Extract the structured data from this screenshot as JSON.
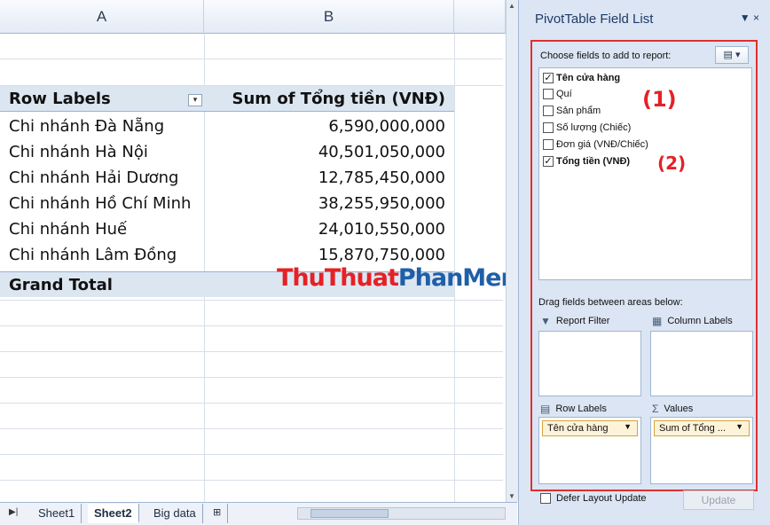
{
  "sheet": {
    "col_a": "A",
    "col_b": "B",
    "header": {
      "row_labels": "Row Labels",
      "sum_label": "Sum of Tổng tiền (VNĐ)"
    },
    "rows": [
      {
        "label": "Chi nhánh Đà Nẵng",
        "value": "6,590,000,000"
      },
      {
        "label": "Chi nhánh Hà Nội",
        "value": "40,501,050,000"
      },
      {
        "label": "Chi nhánh Hải Dương",
        "value": "12,785,450,000"
      },
      {
        "label": "Chi nhánh Hồ Chí Minh",
        "value": "38,255,950,000"
      },
      {
        "label": "Chi nhánh Huế",
        "value": "24,010,550,000"
      },
      {
        "label": "Chi nhánh Lâm Đồng",
        "value": "15,870,750,000"
      }
    ],
    "grand_total": "Grand Total",
    "watermark_red": "ThuThuat",
    "watermark_blue": "PhanMem.vn"
  },
  "tabs": [
    {
      "label": "Sheet1"
    },
    {
      "label": "Sheet2"
    },
    {
      "label": "Big data"
    }
  ],
  "pane": {
    "title": "PivotTable Field List",
    "close": "▼ ×",
    "choose_label": "Choose fields to add to report:",
    "fields": [
      {
        "label": "Tên cửa hàng",
        "checked": true
      },
      {
        "label": "Quí",
        "checked": false
      },
      {
        "label": "Sản phẩm",
        "checked": false
      },
      {
        "label": "Số lượng (Chiếc)",
        "checked": false
      },
      {
        "label": "Đơn giá (VNĐ/Chiếc)",
        "checked": false
      },
      {
        "label": "Tổng tiền (VNĐ)",
        "checked": true
      }
    ],
    "marker1": "(1)",
    "marker2": "(2)",
    "drag_label": "Drag fields between areas below:",
    "report_filter": "Report Filter",
    "column_labels": "Column Labels",
    "row_labels": "Row Labels",
    "values": "Values",
    "row_chip": "Tên cửa hàng",
    "value_chip": "Sum of Tổng ...",
    "defer": "Defer Layout Update",
    "update": "Update"
  }
}
